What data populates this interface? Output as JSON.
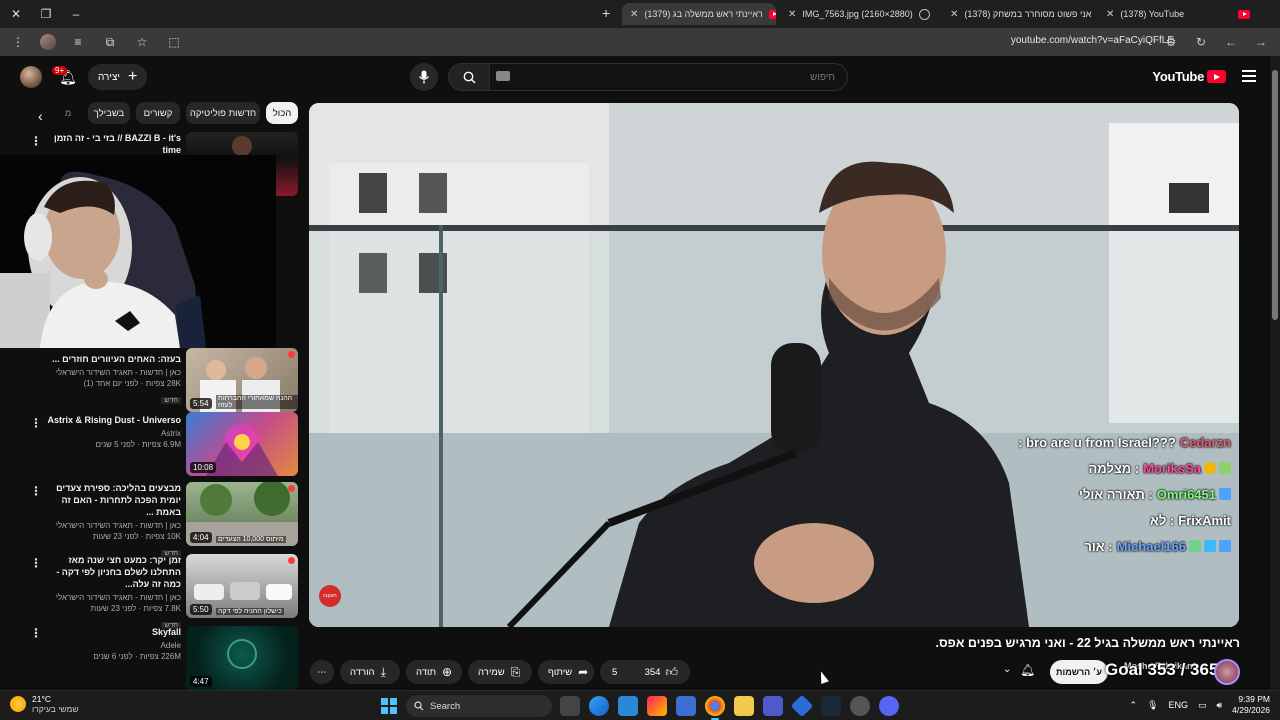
{
  "browser": {
    "tabs": [
      {
        "title": "(1378) YouTube"
      },
      {
        "title": "(1378) אני פשוט מסוחרר במשחק"
      },
      {
        "title": "IMG_7563.jpg (2160×2880)"
      },
      {
        "title": "(1379) ראיינתי ראש ממשלה בג"
      }
    ],
    "url": "youtube.com/watch?v=aFaCyiQFfLE"
  },
  "header": {
    "create_label": "יצירה",
    "notif_badge": "9+",
    "search_placeholder": "חיפוש",
    "logo_text": "YouTube"
  },
  "chips": [
    {
      "label": "הכול"
    },
    {
      "label": "חדשות פוליטיקה"
    },
    {
      "label": "קשורים"
    },
    {
      "label": "בשבילך"
    }
  ],
  "chip_fragment": "מ",
  "sidebar_videos": [
    {
      "title": "BAZZI B - it's // בזי בי - זה הזמן time",
      "channel": "",
      "stats": "",
      "duration": "",
      "new": ""
    },
    {
      "title": "בעזה: האחים העיוורים חוזרים ...",
      "channel": "כאן | חדשות - תאגיד השידור הישראלי",
      "stats": "28K צפיות · לפני יום אחד (1)",
      "duration": "5:54",
      "new": "חדש",
      "cap": "ההנה שמאחורי ההברחות לעזה"
    },
    {
      "title": "Astrix & Rising Dust - Universo",
      "channel": "Astrix",
      "stats": "6.9M צפיות · לפני 5 שנים",
      "duration": "10:08",
      "new": ""
    },
    {
      "title": "מבצעים בהליכה: ספירת צעדים יומית הפכה לתחרות - האם זה באמת ...",
      "channel": "כאן | חדשות - תאגיד השידור הישראלי",
      "stats": "10K צפיות · לפני 23 שעות",
      "duration": "4:04",
      "new": "חדש",
      "cap": "מיתוס 10,000 הצעדים"
    },
    {
      "title": "זמן יקר: כמעט חצי שנה מאז התחלנו לשלם בחניון לפי דקה - כמה זה עלה...",
      "channel": "כאן | חדשות - תאגיד השידור הישראלי",
      "stats": "7.8K צפיות · לפני 23 שעות",
      "duration": "5:50",
      "new": "חדש",
      "cap": "כישלון החניה לפי דקה"
    },
    {
      "title": "Skyfall",
      "channel": "Adele",
      "stats": "226M צפיות · לפני 6 שנים",
      "duration": "4:47",
      "new": ""
    }
  ],
  "chat": [
    {
      "user": "Cedarzn",
      "msg": ": bro are u from Israel???",
      "color": "#e0607a"
    },
    {
      "user": "MoriksSa",
      "msg": ": מצלמה",
      "color": "#ff4f9a"
    },
    {
      "user": "Omri6451",
      "msg": ": תאורה אולי",
      "color": "#7cfc7c"
    },
    {
      "user": "FrixAmit",
      "msg": ": לא",
      "color": "#ffffff"
    },
    {
      "user": "Michael166",
      "msg": ": אור",
      "color": "#6aa9ff"
    }
  ],
  "rec_badge": "תעקבו",
  "video": {
    "title": "ראיינתי ראש ממשלה בגיל 22 - ואני מרגיש בפנים אפס.",
    "download": "הורדה",
    "thanks": "תודה",
    "save": "שמירה",
    "share": "שיתוף",
    "dislikes": "5",
    "likes": "354",
    "subscribed": "ע׳ הרשמות",
    "channel_name": "Moshe Fabrikant",
    "goal": "Goal 353 / 365"
  },
  "taskbar": {
    "temp": "21°C",
    "weather": "שמשי בעיקרו",
    "search": "Search",
    "lang": "ENG",
    "time": "9:39 PM",
    "date": "4/29/2026"
  }
}
